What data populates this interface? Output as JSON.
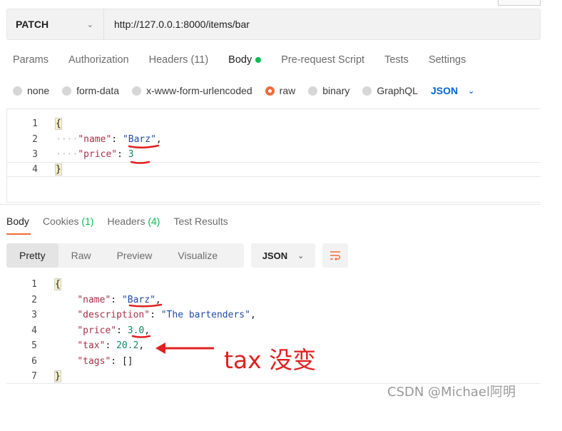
{
  "request": {
    "method": "PATCH",
    "url": "http://127.0.0.1:8000/items/bar"
  },
  "request_tabs": [
    {
      "label": "Params"
    },
    {
      "label": "Authorization"
    },
    {
      "label": "Headers",
      "count": "(11)"
    },
    {
      "label": "Body"
    },
    {
      "label": "Pre-request Script"
    },
    {
      "label": "Tests"
    },
    {
      "label": "Settings"
    }
  ],
  "body_types": [
    "none",
    "form-data",
    "x-www-form-urlencoded",
    "raw",
    "binary",
    "GraphQL"
  ],
  "body_format": "JSON",
  "request_body": {
    "line_numbers": [
      "1",
      "2",
      "3",
      "4"
    ],
    "open_brace": "{",
    "name_key": "\"name\"",
    "name_value": "\"Barz\"",
    "price_key": "\"price\"",
    "price_value": "3",
    "close_brace": "}"
  },
  "response_tabs": [
    {
      "label": "Body"
    },
    {
      "label": "Cookies",
      "count": "(1)"
    },
    {
      "label": "Headers",
      "count": "(4)"
    },
    {
      "label": "Test Results"
    }
  ],
  "view_tabs": [
    "Pretty",
    "Raw",
    "Preview",
    "Visualize"
  ],
  "response_format": "JSON",
  "response_body": {
    "line_numbers": [
      "1",
      "2",
      "3",
      "4",
      "5",
      "6",
      "7"
    ],
    "open_brace": "{",
    "name_key": "\"name\"",
    "name_value": "\"Barz\"",
    "description_key": "\"description\"",
    "description_value": "\"The bartenders\"",
    "price_key": "\"price\"",
    "price_value": "3.0",
    "tax_key": "\"tax\"",
    "tax_value": "20.2",
    "tags_key": "\"tags\"",
    "tags_value": "[]",
    "close_brace": "}"
  },
  "annotation": "tax 没变",
  "watermark": "CSDN @Michael阿明",
  "colors": {
    "accent": "#f26b3a",
    "json_blue": "#0265d2",
    "annotation_red": "#e02020",
    "success_green": "#0cbb52"
  }
}
